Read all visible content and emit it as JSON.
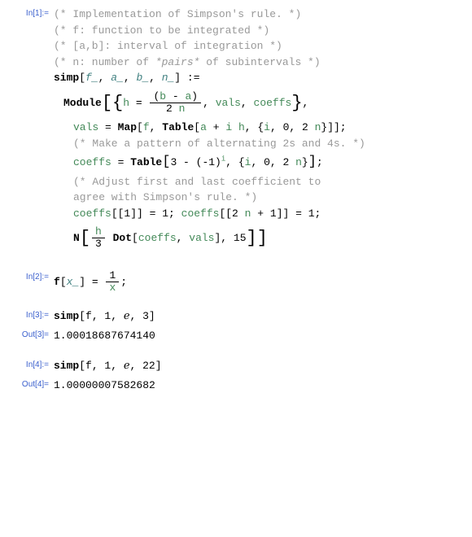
{
  "labels": {
    "in1": "In[1]:=",
    "in2": "In[2]:=",
    "in3": "In[3]:=",
    "out3": "Out[3]=",
    "in4": "In[4]:=",
    "out4": "Out[4]="
  },
  "in1": {
    "c1a": "(* Implementation of Simpson's rule.       *)",
    "c2a": "(*  f:  function to be integrated           *)",
    "c3a": "(*  [a,b]:  interval of integration         *)",
    "c4a": "(*  n:  number of ",
    "c4b": "*pairs*",
    "c4c": " of subintervals *)",
    "def_simp": "simp",
    "def_obr": "[",
    "def_f": "f_",
    "def_c1": ", ",
    "def_a": "a_",
    "def_c2": ", ",
    "def_b": "b_",
    "def_c3": ", ",
    "def_n": "n_",
    "def_cbr": "] :=",
    "mod": "Module",
    "h_eq": "h",
    "h_assign": " = ",
    "frac1_top_l": "(",
    "frac1_top_b": "b",
    "frac1_top_m": " - ",
    "frac1_top_a": "a",
    "frac1_top_r": ")",
    "frac1_bot_2": "2 ",
    "frac1_bot_n": "n",
    "after_h_c": ", ",
    "vals": "vals",
    "c_vc": ", ",
    "coeffs": "coeffs",
    "vals2": "vals",
    "vals_eq": " = ",
    "map": "Map",
    "map_l": "[",
    "map_f": "f",
    "map_c": ", ",
    "table": "Table",
    "table_l": "[",
    "table_a": "a",
    "table_p": " + ",
    "table_i": "i",
    "table_sp": " ",
    "table_h": "h",
    "table_c": ", {",
    "table_i2": "i",
    "table_c2": ", 0, 2 ",
    "table_n": "n",
    "table_r": "}]];",
    "c5": "(* Make a pattern of alternating 2s and 4s. *)",
    "coeffs2": "coeffs",
    "coeffs_eq": " = ",
    "table2": "Table",
    "t2_body_3": "3 - (-1)",
    "t2_sup": "i",
    "t2_c": ", {",
    "t2_i": "i",
    "t2_cc": ", 0, 2 ",
    "t2_n": "n",
    "t2_r": "}",
    "semi": ";",
    "c6a": "(* Adjust first and last coefficient to",
    "c6b": " agree with Simpson's rule. *)",
    "cf1": "coeffs",
    "cf1_idx": "[[1]] = 1; ",
    "cf2": "coeffs",
    "cf2_idx": "[[2 ",
    "cf2_n": "n",
    "cf2_r": " + 1]] = 1;",
    "N": "N",
    "N_h": "h",
    "N_3": "3",
    "dot": " Dot",
    "dot_l": "[",
    "dot_c": "coeffs",
    "dot_cc": ", ",
    "dot_v": "vals",
    "dot_r": "], 15"
  },
  "in2": {
    "f": "f",
    "l": "[",
    "x": "x_",
    "r": "] = ",
    "top": "1",
    "bot": "x",
    "semi": ";"
  },
  "in3": {
    "call": "simp",
    "args": "[f, 1, ℯ, 3]"
  },
  "out3": {
    "val": "1.00018687674140"
  },
  "in4": {
    "call": "simp",
    "args": "[f, 1, ℯ, 22]"
  },
  "out4": {
    "val": "1.00000007582682"
  }
}
